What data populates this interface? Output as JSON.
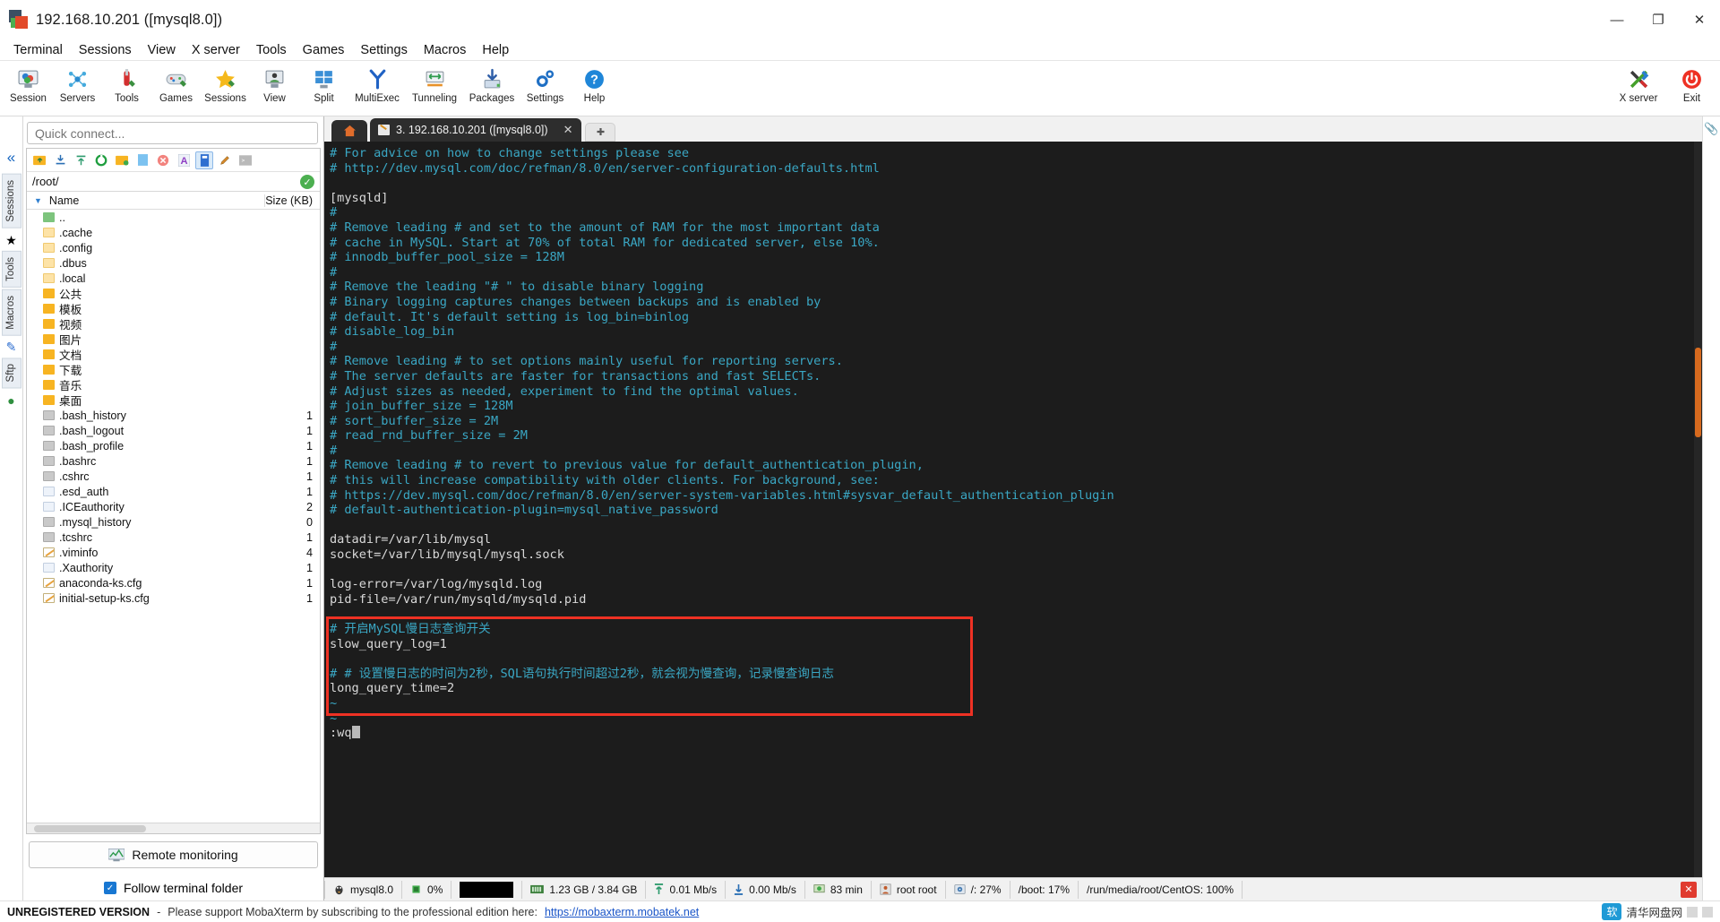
{
  "window": {
    "title": "192.168.10.201 ([mysql8.0])",
    "minimize": "—",
    "restore": "❐",
    "close": "✕"
  },
  "menubar": [
    "Terminal",
    "Sessions",
    "View",
    "X server",
    "Tools",
    "Games",
    "Settings",
    "Macros",
    "Help"
  ],
  "toolbar": {
    "left": [
      {
        "label": "Session",
        "icon": "session-icon"
      },
      {
        "label": "Servers",
        "icon": "servers-icon"
      },
      {
        "label": "Tools",
        "icon": "tools-icon"
      },
      {
        "label": "Games",
        "icon": "games-icon"
      },
      {
        "label": "Sessions",
        "icon": "sessions-star-icon"
      },
      {
        "label": "View",
        "icon": "view-icon"
      },
      {
        "label": "Split",
        "icon": "split-icon"
      },
      {
        "label": "MultiExec",
        "icon": "multiexec-icon"
      },
      {
        "label": "Tunneling",
        "icon": "tunneling-icon"
      },
      {
        "label": "Packages",
        "icon": "packages-icon"
      },
      {
        "label": "Settings",
        "icon": "settings-gear-icon"
      },
      {
        "label": "Help",
        "icon": "help-icon"
      }
    ],
    "right": [
      {
        "label": "X server",
        "icon": "x-server-icon"
      },
      {
        "label": "Exit",
        "icon": "exit-power-icon"
      }
    ]
  },
  "sidebar": {
    "quick_connect_placeholder": "Quick connect...",
    "rail_tabs": [
      "Sessions",
      "Tools",
      "Macros",
      "Sftp"
    ],
    "path": "/root/",
    "columns": {
      "name": "Name",
      "size": "Size (KB)"
    },
    "sftp_buttons": [
      "up-folder-icon",
      "download-icon",
      "upload-icon",
      "refresh-icon",
      "new-folder-icon",
      "new-file-icon",
      "delete-icon",
      "text-mode-icon",
      "binary-mode-icon",
      "edit-icon",
      "terminal-icon"
    ],
    "files": [
      {
        "name": "..",
        "size": "",
        "type": "up"
      },
      {
        "name": ".cache",
        "size": "",
        "type": "folder-light"
      },
      {
        "name": ".config",
        "size": "",
        "type": "folder-light"
      },
      {
        "name": ".dbus",
        "size": "",
        "type": "folder-light"
      },
      {
        "name": ".local",
        "size": "",
        "type": "folder-light"
      },
      {
        "name": "公共",
        "size": "",
        "type": "folder"
      },
      {
        "name": "模板",
        "size": "",
        "type": "folder"
      },
      {
        "name": "视频",
        "size": "",
        "type": "folder"
      },
      {
        "name": "图片",
        "size": "",
        "type": "folder"
      },
      {
        "name": "文档",
        "size": "",
        "type": "folder"
      },
      {
        "name": "下载",
        "size": "",
        "type": "folder"
      },
      {
        "name": "音乐",
        "size": "",
        "type": "folder"
      },
      {
        "name": "桌面",
        "size": "",
        "type": "folder"
      },
      {
        "name": ".bash_history",
        "size": "1",
        "type": "term"
      },
      {
        "name": ".bash_logout",
        "size": "1",
        "type": "term"
      },
      {
        "name": ".bash_profile",
        "size": "1",
        "type": "term"
      },
      {
        "name": ".bashrc",
        "size": "1",
        "type": "term"
      },
      {
        "name": ".cshrc",
        "size": "1",
        "type": "term"
      },
      {
        "name": ".esd_auth",
        "size": "1",
        "type": "doc"
      },
      {
        "name": ".ICEauthority",
        "size": "2",
        "type": "doc"
      },
      {
        "name": ".mysql_history",
        "size": "0",
        "type": "term"
      },
      {
        "name": ".tcshrc",
        "size": "1",
        "type": "term"
      },
      {
        "name": ".viminfo",
        "size": "4",
        "type": "cfg"
      },
      {
        "name": ".Xauthority",
        "size": "1",
        "type": "doc"
      },
      {
        "name": "anaconda-ks.cfg",
        "size": "1",
        "type": "cfg"
      },
      {
        "name": "initial-setup-ks.cfg",
        "size": "1",
        "type": "cfg"
      }
    ],
    "remote_monitoring": "Remote monitoring",
    "follow_terminal_folder": "Follow terminal folder"
  },
  "tabs": {
    "home_icon": "home-icon",
    "active_tab": "3. 192.168.10.201 ([mysql8.0])",
    "close_glyph": "✕",
    "new_tab_glyph": "✚"
  },
  "terminal": {
    "lines": [
      {
        "t": "# For advice on how to change settings please see",
        "c": true
      },
      {
        "t": "# http://dev.mysql.com/doc/refman/8.0/en/server-configuration-defaults.html",
        "c": true
      },
      {
        "t": "",
        "c": false
      },
      {
        "t": "[mysqld]",
        "c": false
      },
      {
        "t": "#",
        "c": true
      },
      {
        "t": "# Remove leading # and set to the amount of RAM for the most important data",
        "c": true
      },
      {
        "t": "# cache in MySQL. Start at 70% of total RAM for dedicated server, else 10%.",
        "c": true
      },
      {
        "t": "# innodb_buffer_pool_size = 128M",
        "c": true
      },
      {
        "t": "#",
        "c": true
      },
      {
        "t": "# Remove the leading \"# \" to disable binary logging",
        "c": true
      },
      {
        "t": "# Binary logging captures changes between backups and is enabled by",
        "c": true
      },
      {
        "t": "# default. It's default setting is log_bin=binlog",
        "c": true
      },
      {
        "t": "# disable_log_bin",
        "c": true
      },
      {
        "t": "#",
        "c": true
      },
      {
        "t": "# Remove leading # to set options mainly useful for reporting servers.",
        "c": true
      },
      {
        "t": "# The server defaults are faster for transactions and fast SELECTs.",
        "c": true
      },
      {
        "t": "# Adjust sizes as needed, experiment to find the optimal values.",
        "c": true
      },
      {
        "t": "# join_buffer_size = 128M",
        "c": true
      },
      {
        "t": "# sort_buffer_size = 2M",
        "c": true
      },
      {
        "t": "# read_rnd_buffer_size = 2M",
        "c": true
      },
      {
        "t": "#",
        "c": true
      },
      {
        "t": "# Remove leading # to revert to previous value for default_authentication_plugin,",
        "c": true
      },
      {
        "t": "# this will increase compatibility with older clients. For background, see:",
        "c": true
      },
      {
        "t": "# https://dev.mysql.com/doc/refman/8.0/en/server-system-variables.html#sysvar_default_authentication_plugin",
        "c": true
      },
      {
        "t": "# default-authentication-plugin=mysql_native_password",
        "c": true
      },
      {
        "t": "",
        "c": false
      },
      {
        "t": "datadir=/var/lib/mysql",
        "c": false
      },
      {
        "t": "socket=/var/lib/mysql/mysql.sock",
        "c": false
      },
      {
        "t": "",
        "c": false
      },
      {
        "t": "log-error=/var/log/mysqld.log",
        "c": false
      },
      {
        "t": "pid-file=/var/run/mysqld/mysqld.pid",
        "c": false
      },
      {
        "t": "",
        "c": false
      },
      {
        "t": "# 开启MySQL慢日志查询开关",
        "c": true
      },
      {
        "t": "slow_query_log=1",
        "c": false
      },
      {
        "t": "",
        "c": false
      },
      {
        "t": "# # 设置慢日志的时间为2秒，SQL语句执行时间超过2秒，就会视为慢查询，记录慢查询日志",
        "c": true
      },
      {
        "t": "long_query_time=2",
        "c": false
      },
      {
        "t": "~",
        "c": true
      },
      {
        "t": "~",
        "c": true
      },
      {
        "t": ":wq",
        "c": false
      }
    ]
  },
  "statusbar": {
    "items": [
      {
        "icon": "linux-icon",
        "label": "mysql8.0"
      },
      {
        "icon": "cpu-icon",
        "label": "0%"
      },
      {
        "icon": "black-chip",
        "label": ""
      },
      {
        "icon": "memory-icon",
        "label": "1.23 GB / 3.84 GB"
      },
      {
        "icon": "upload-arrow-icon",
        "label": "0.01 Mb/s"
      },
      {
        "icon": "download-arrow-icon",
        "label": "0.00 Mb/s"
      },
      {
        "icon": "uptime-icon",
        "label": "83 min"
      },
      {
        "icon": "user-icon",
        "label": "root  root"
      },
      {
        "icon": "disk-icon",
        "label": "/: 27%"
      },
      {
        "icon": "",
        "label": "/boot: 17%"
      },
      {
        "icon": "",
        "label": "/run/media/root/CentOS: 100%"
      }
    ],
    "close_glyph": "✕"
  },
  "bottombar": {
    "unregistered": "UNREGISTERED VERSION",
    "dash": "-",
    "message": "Please support MobaXterm by subscribing to the professional edition here:",
    "link": "https://mobaxterm.mobatek.net",
    "watermark_badge": "软",
    "watermark_text": "清华网盘网"
  },
  "colors": {
    "accent": "#1877d2",
    "terminal_bg": "#1c1c1c",
    "comment": "#3aa7c4",
    "highlight_box": "#ee3124",
    "link": "#1a55c8"
  }
}
